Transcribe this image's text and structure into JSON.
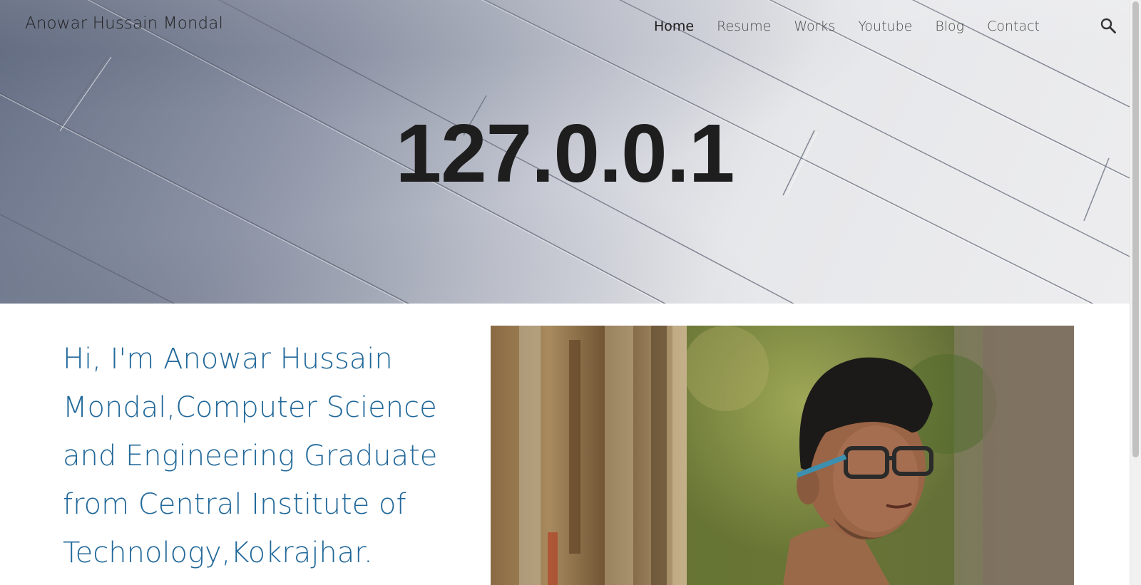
{
  "header": {
    "site_title": "Anowar Hussain Mondal",
    "nav": [
      {
        "label": "Home",
        "active": true
      },
      {
        "label": "Resume",
        "active": false
      },
      {
        "label": "Works",
        "active": false
      },
      {
        "label": "Youtube",
        "active": false
      },
      {
        "label": "Blog",
        "active": false
      },
      {
        "label": "Contact",
        "active": false
      }
    ],
    "search_icon": "search-icon"
  },
  "hero": {
    "title": "127.0.0.1"
  },
  "main": {
    "intro_text": "Hi, I'm Anowar Hussain Mondal,Computer Science and Engineering Graduate from Central Institute of Technology,Kokrajhar."
  },
  "colors": {
    "intro_text": "#22699a",
    "hero_title": "#1e1e1e",
    "nav_active": "#1d1d1d",
    "nav_inactive": "#4a4a4a"
  }
}
